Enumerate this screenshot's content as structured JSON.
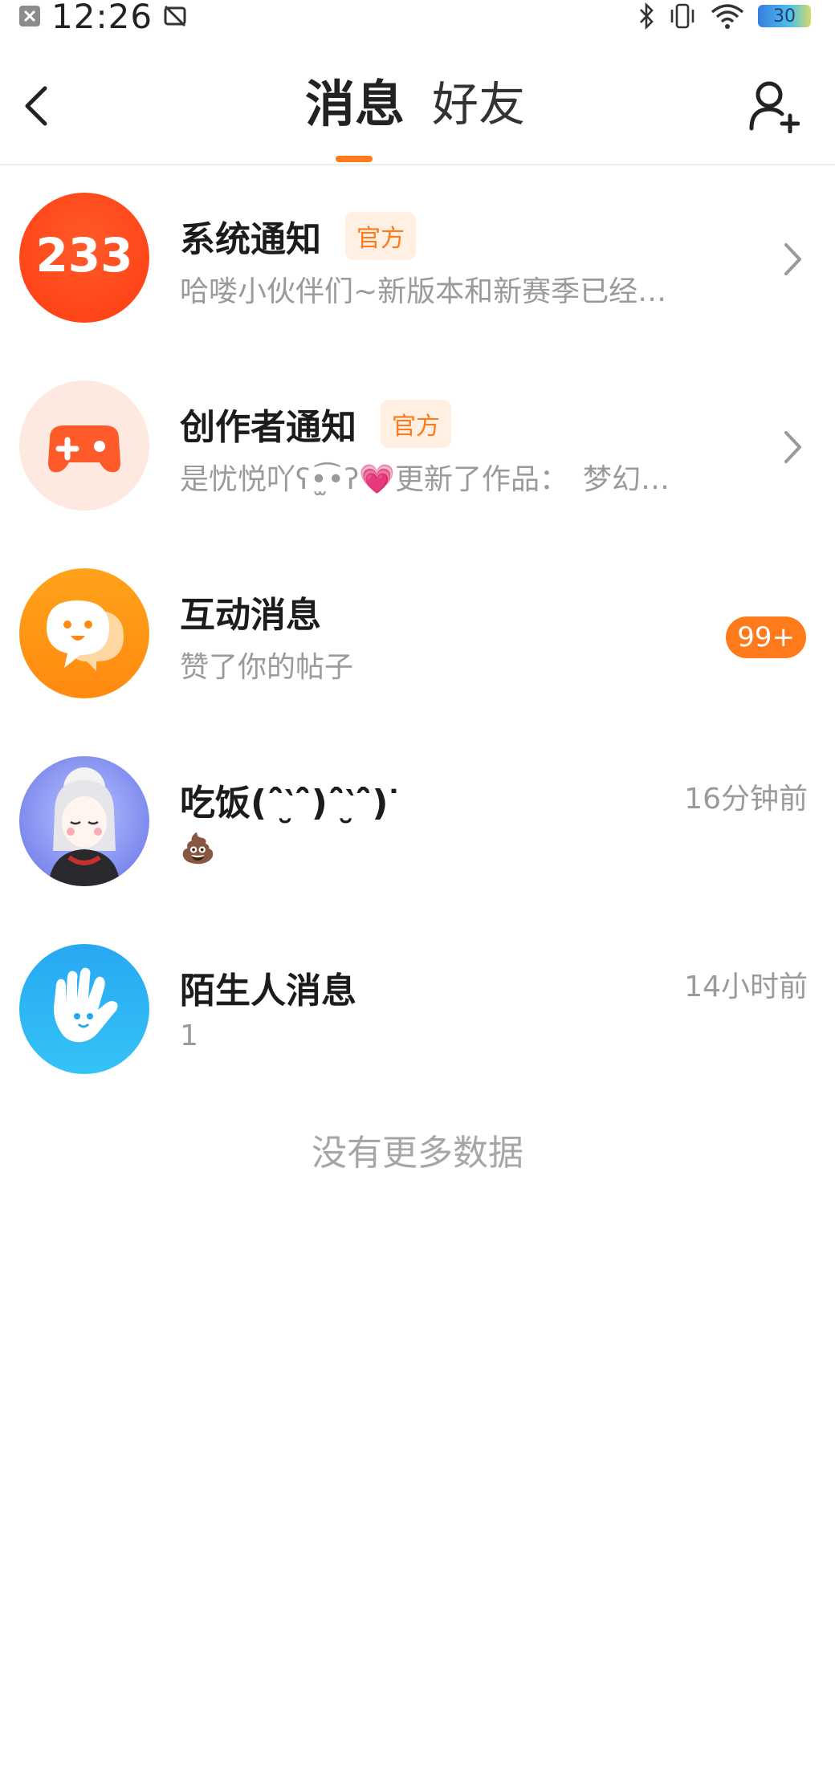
{
  "status_bar": {
    "time": "12:26",
    "battery": "30"
  },
  "nav": {
    "tabs": [
      {
        "label": "消息"
      },
      {
        "label": "好友"
      }
    ]
  },
  "messages": [
    {
      "title": "系统通知",
      "tag": "官方",
      "preview": "哈喽小伙伴们~新版本和新赛季已经…",
      "avatar_text": "233"
    },
    {
      "title": "创作者通知",
      "tag": "官方",
      "preview": "是忧悦吖ʕ•̫͡•ʔ💗更新了作品：　梦幻…"
    },
    {
      "title": "互动消息",
      "preview": "赞了你的帖子",
      "badge": "99+"
    },
    {
      "title": "吃饭(ˆ̑‵̮ˆ̑)ˆ̑‵̮ˆ̑)ᐝ",
      "preview": "💩",
      "time": "16分钟前"
    },
    {
      "title": "陌生人消息",
      "preview": "1",
      "time": "14小时前"
    }
  ],
  "footer": {
    "no_more": "没有更多数据"
  },
  "colors": {
    "accent": "#ff7a1a",
    "official_bg": "#fff0e3"
  }
}
